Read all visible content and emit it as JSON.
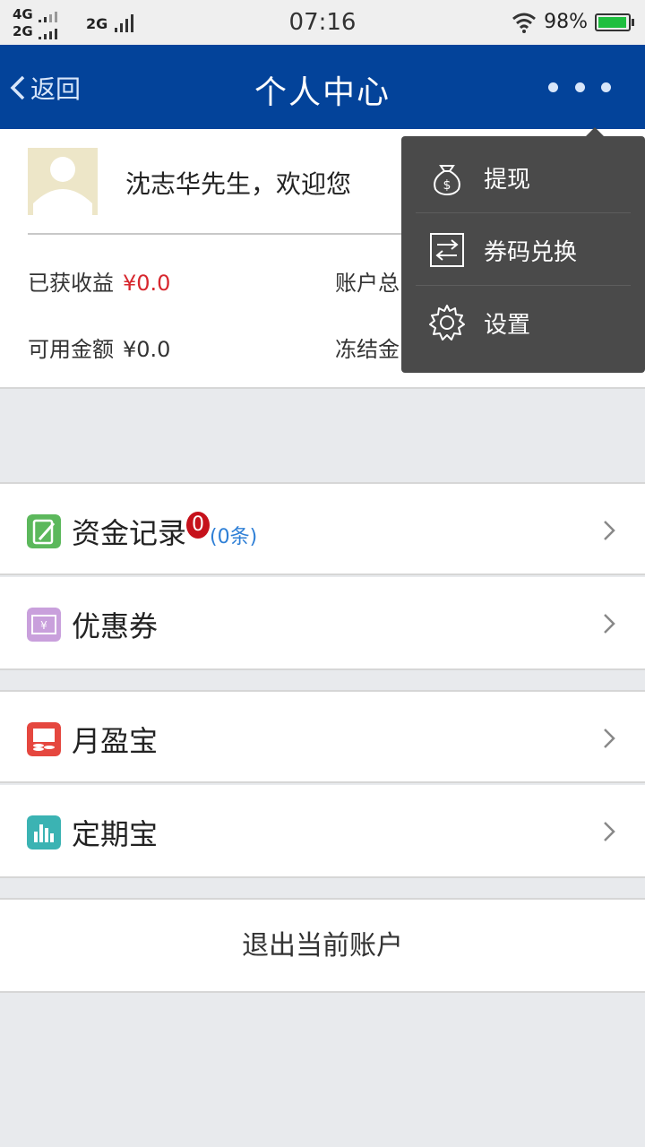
{
  "status_bar": {
    "net1": "4G",
    "net2": "2G",
    "net3": "2G",
    "time": "07:16",
    "battery": "98%",
    "battery_level": 0.98
  },
  "nav": {
    "back_label": "返回",
    "title": "个人中心"
  },
  "profile": {
    "greeting": "沈志华先生，欢迎您",
    "earned_label": "已获收益",
    "earned_value": "¥0.0",
    "available_label": "可用金额",
    "available_value": "¥0.0",
    "account_total_label": "账户总",
    "frozen_label": "冻结金"
  },
  "list": {
    "fund_records": {
      "label": "资金记录",
      "badge": "0",
      "count": "(0条)"
    },
    "coupons": {
      "label": "优惠券"
    },
    "monthly": {
      "label": "月盈宝"
    },
    "fixed": {
      "label": "定期宝"
    }
  },
  "logout_label": "退出当前账户",
  "popup_menu": {
    "items": [
      {
        "label": "提现",
        "icon": "money-bag-icon"
      },
      {
        "label": "券码兑换",
        "icon": "exchange-icon"
      },
      {
        "label": "设置",
        "icon": "gear-icon"
      }
    ]
  },
  "colors": {
    "nav": "#03439a",
    "accent_red": "#d7272e",
    "link_blue": "#2e7fd6",
    "fund_icon": "#5cb85c",
    "coupon_icon": "#c9a0dc",
    "monthly_icon": "#e5473f",
    "fixed_icon": "#3bb3b3"
  }
}
